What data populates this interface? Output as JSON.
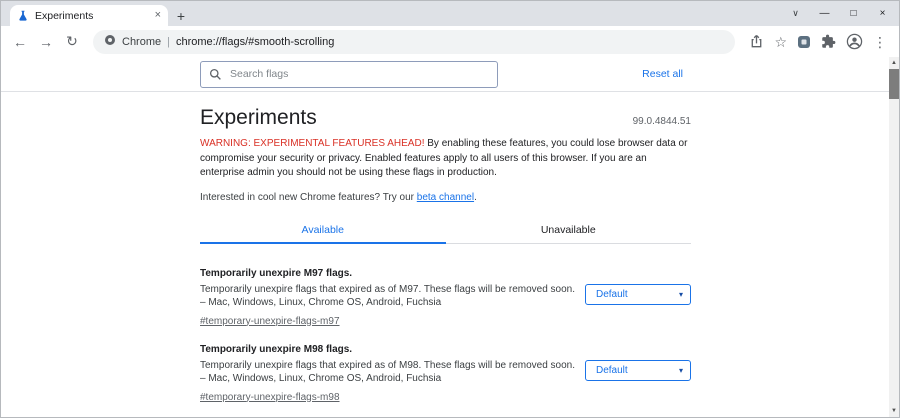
{
  "browser": {
    "tab_title": "Experiments",
    "omnibox_chip": "Chrome",
    "omnibox_separator": "|",
    "url": "chrome://flags/#smooth-scrolling"
  },
  "icons": {
    "back": "←",
    "forward": "→",
    "reload": "↻",
    "close": "×",
    "plus": "+",
    "minimize": "—",
    "maximize": "□",
    "chevron_down": "∨",
    "star": "☆",
    "kebab": "⋮",
    "select_caret": "▾",
    "scroll_up": "▲",
    "scroll_down": "▼"
  },
  "colors": {
    "accent": "#1a73e8",
    "warning_red": "#d93025",
    "link_gray": "#5f6368"
  },
  "flags_page": {
    "search_placeholder": "Search flags",
    "reset_all": "Reset all",
    "title": "Experiments",
    "version": "99.0.4844.51",
    "warning_emphasis": "WARNING: EXPERIMENTAL FEATURES AHEAD!",
    "warning_body": " By enabling these features, you could lose browser data or compromise your security or privacy. Enabled features apply to all users of this browser. If you are an enterprise admin you should not be using these flags in production.",
    "promo_prefix": "Interested in cool new Chrome features? Try our ",
    "promo_link": "beta channel",
    "promo_suffix": ".",
    "tabs": [
      {
        "label": "Available",
        "active": true
      },
      {
        "label": "Unavailable",
        "active": false
      }
    ],
    "flags": [
      {
        "title": "Temporarily unexpire M97 flags.",
        "description": "Temporarily unexpire flags that expired as of M97. These flags will be removed soon. – Mac, Windows, Linux, Chrome OS, Android, Fuchsia",
        "anchor": "#temporary-unexpire-flags-m97",
        "value": "Default"
      },
      {
        "title": "Temporarily unexpire M98 flags.",
        "description": "Temporarily unexpire flags that expired as of M98. These flags will be removed soon. – Mac, Windows, Linux, Chrome OS, Android, Fuchsia",
        "anchor": "#temporary-unexpire-flags-m98",
        "value": "Default"
      }
    ]
  }
}
